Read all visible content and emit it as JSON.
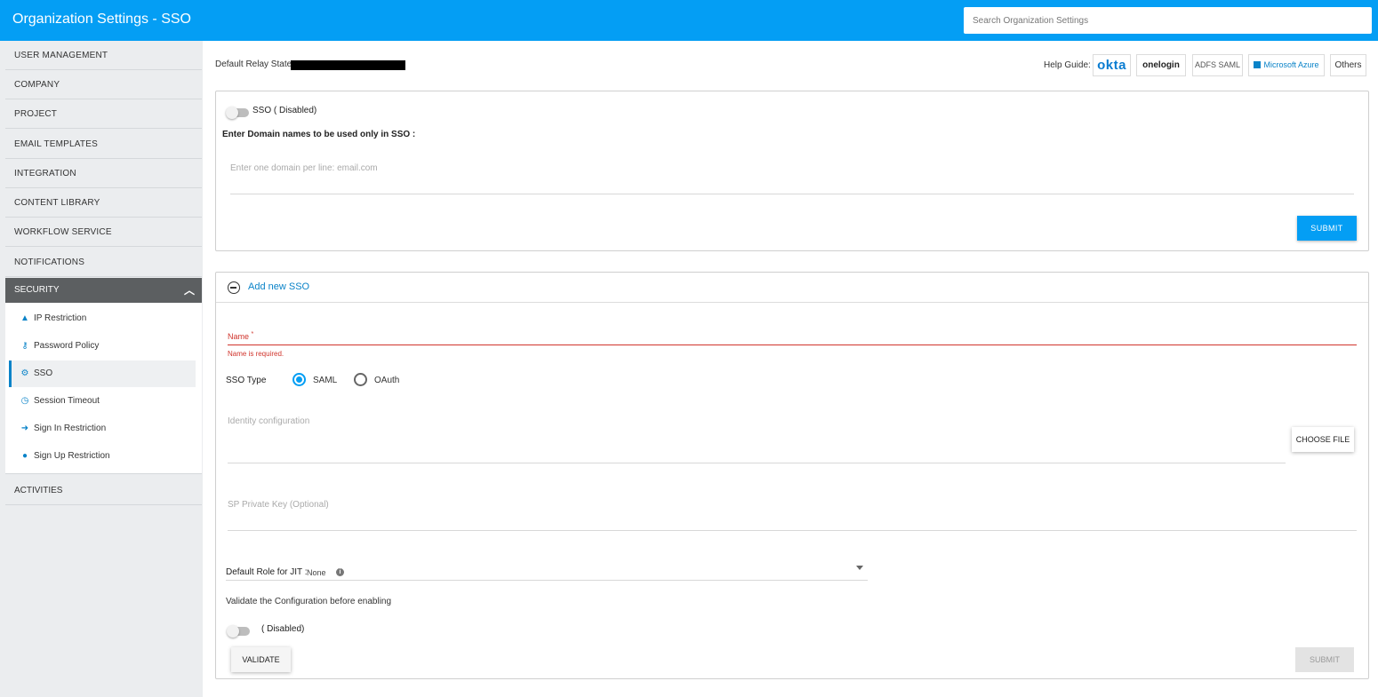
{
  "header": {
    "title": "Organization Settings - SSO",
    "search_placeholder": "Search Organization Settings",
    "accent_color": "#049ef4"
  },
  "sidebar": {
    "items": [
      {
        "label": "USER MANAGEMENT"
      },
      {
        "label": "COMPANY"
      },
      {
        "label": "PROJECT"
      },
      {
        "label": "EMAIL TEMPLATES"
      },
      {
        "label": "INTEGRATION"
      },
      {
        "label": "CONTENT LIBRARY"
      },
      {
        "label": "WORKFLOW SERVICE"
      },
      {
        "label": "NOTIFICATIONS"
      }
    ],
    "security": {
      "label": "SECURITY",
      "expanded": true,
      "sub_items": [
        {
          "label": "IP Restriction",
          "icon": "warning-icon"
        },
        {
          "label": "Password Policy",
          "icon": "key-icon"
        },
        {
          "label": "SSO",
          "icon": "gears-icon",
          "active": true
        },
        {
          "label": "Session Timeout",
          "icon": "clock-icon"
        },
        {
          "label": "Sign In Restriction",
          "icon": "sign-in-icon"
        },
        {
          "label": "Sign Up Restriction",
          "icon": "user-plus-icon"
        }
      ]
    },
    "activities_label": "ACTIVITIES"
  },
  "main": {
    "relay_state_label": "Default Relay State",
    "relay_state_value": "",
    "help_guide": {
      "label": "Help Guide:",
      "links": [
        "okta",
        "onelogin",
        "ADFS SAML",
        "Microsoft Azure",
        "Others"
      ]
    },
    "sso_card": {
      "status": "SSO ( Disabled)",
      "enabled": false,
      "domain_label": "Enter Domain names to be used only in SSO :",
      "domain_placeholder": "Enter one domain per line: email.com",
      "submit_label": "SUBMIT"
    },
    "add_sso": {
      "title": "Add new SSO",
      "name_label": "Name",
      "required_mark": "*",
      "name_error": "Name is required.",
      "sso_type_label": "SSO Type",
      "sso_type_options": [
        "SAML",
        "OAuth"
      ],
      "sso_type_selected": "SAML",
      "identity_config_label": "Identity configuration",
      "choose_file_label": "CHOOSE FILE",
      "sp_private_key_label": "SP Private Key (Optional)",
      "jit_label": "Default Role for JIT :",
      "jit_value": "None",
      "validate_text": "Validate the Configuration before enabling",
      "validate_status": "( Disabled)",
      "validate_enabled": false,
      "validate_label": "VALIDATE",
      "submit_label": "SUBMIT"
    }
  }
}
